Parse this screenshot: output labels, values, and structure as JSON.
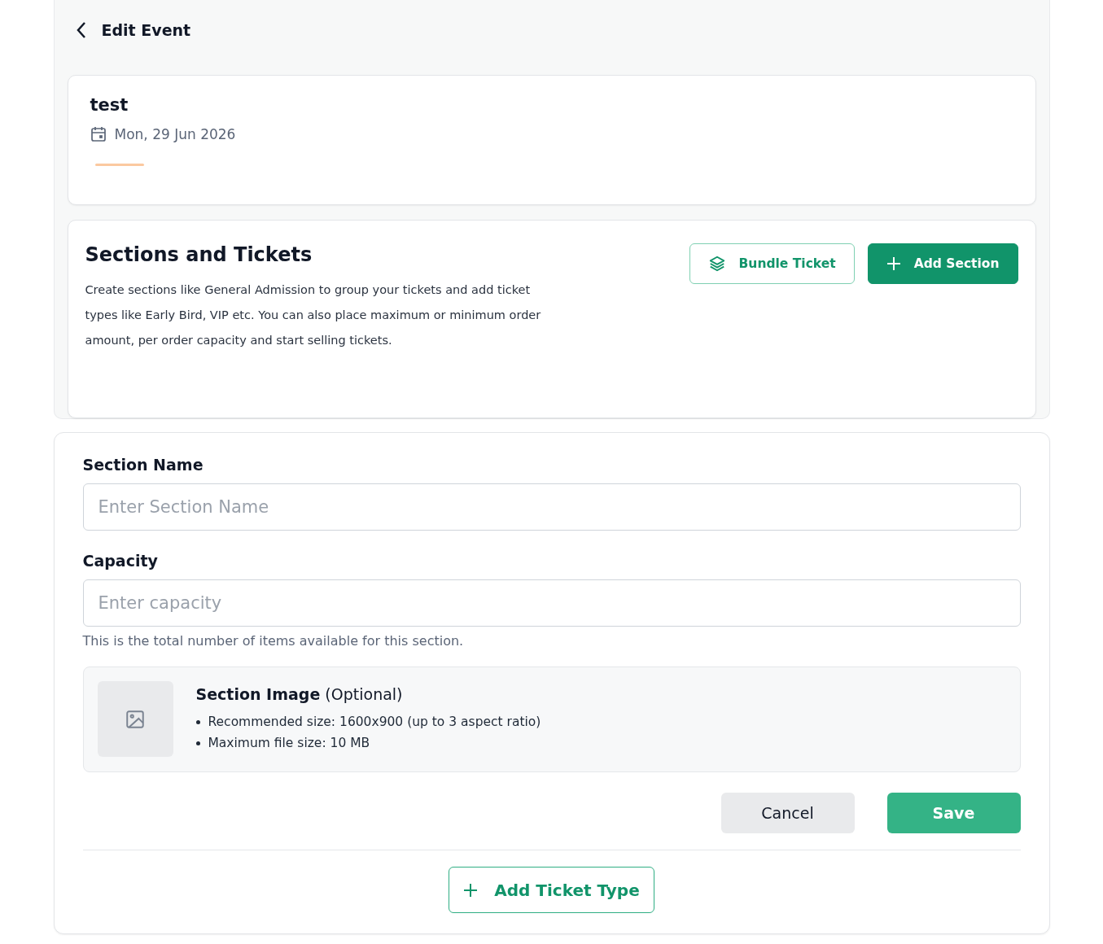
{
  "header": {
    "title": "Edit Event"
  },
  "event": {
    "name": "test",
    "date": "Mon, 29 Jun 2026"
  },
  "sections": {
    "title": "Sections and Tickets",
    "description": "Create sections like General Admission to group your tickets and add ticket types like Early Bird, VIP etc. You can also place maximum or minimum order amount, per order capacity and start selling tickets.",
    "buttons": [
      {
        "label": "Bundle Ticket",
        "kind": "outline"
      },
      {
        "label": "Add Section",
        "kind": "primary"
      }
    ]
  },
  "form": {
    "fields": [
      {
        "label": "Section Name",
        "placeholder": "Enter Section Name"
      },
      {
        "label": "Capacity",
        "placeholder": "Enter capacity",
        "help": "This is the total number of items available for this section."
      }
    ],
    "image": {
      "title": "**Section Image** (Optional)",
      "notes": [
        "Recommended size: 1600x900 (up to 3 aspect ratio)",
        "Maximum file size: 10 MB"
      ]
    },
    "actions": [
      {
        "label": "Cancel",
        "kind": "secondary"
      },
      {
        "label": "Save",
        "kind": "primary"
      }
    ],
    "add_ticket": "Add Ticket Type"
  }
}
